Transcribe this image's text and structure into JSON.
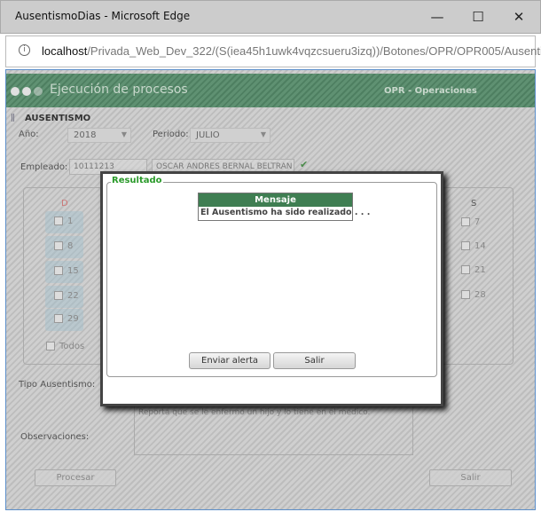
{
  "window": {
    "title": "AusentismoDias - Microsoft Edge",
    "minimize": "—",
    "maximize": "☐",
    "close": "✕"
  },
  "address": {
    "host": "localhost",
    "path": "/Privada_Web_Dev_322/(S(iea45h1uwk4vqzcsueru3izq))/Botones/OPR/OPR005/Ausentis"
  },
  "header": {
    "title": "Ejecución de procesos",
    "module": "OPR - Operaciones",
    "accent": "#4e7f61"
  },
  "section": "AUSENTISMO",
  "form": {
    "year_label": "Año:",
    "year": "2018",
    "period_label": "Periodo:",
    "period": "JULIO",
    "employee_label": "Empleado:",
    "employee_id": "10111213",
    "employee_name": "OSCAR ANDRES BERNAL BELTRAN",
    "tipo_label": "Tipo Ausentismo:",
    "obs_label": "Observaciones:",
    "obs": "Reporta que se le enfermo un hijo y lo tiene en el medico.",
    "process": "Procesar",
    "exit": "Salir"
  },
  "calendar": {
    "col_d": "D",
    "col_s": "S",
    "days_d": [
      "1",
      "8",
      "15",
      "22",
      "29"
    ],
    "days_s": [
      "7",
      "14",
      "21",
      "28"
    ],
    "all": "Todos"
  },
  "modal": {
    "legend": "Resultado",
    "col": "Mensaje",
    "message": "El Ausentismo ha sido realizado . . .",
    "send": "Enviar alerta",
    "exit": "Salir"
  }
}
